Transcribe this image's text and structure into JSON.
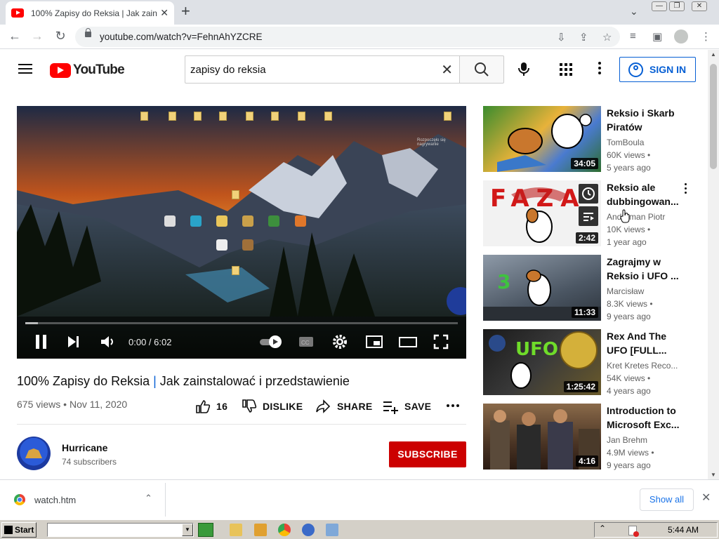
{
  "browser": {
    "tab_title": "100% Zapisy do Reksia | Jak zainstalować i przedstawienie",
    "url": "youtube.com/watch?v=FehnAhYZCRE"
  },
  "masthead": {
    "logo_text": "YouTube",
    "search_query": "zapisy do reksia",
    "sign_in_label": "SIGN IN"
  },
  "player": {
    "time": "0:00 / 6:02",
    "overlay_text": "Rozpoczęło się nagrywanie",
    "progress": 0
  },
  "video": {
    "title_part1": "100% Zapisy do Reksia",
    "title_sep": " | ",
    "title_part2": "Jak zainstalować i przedstawienie",
    "views": "675 views",
    "date": "Nov 11, 2020",
    "likes": "16",
    "dislike_label": "DISLIKE",
    "share_label": "SHARE",
    "save_label": "SAVE"
  },
  "channel": {
    "name": "Hurricane",
    "subscribers": "74 subscribers",
    "subscribe_label": "SUBSCRIBE"
  },
  "sidebar": [
    {
      "title": "Reksio i Skarb Piratów",
      "channel": "TomBoula",
      "views": "60K views •",
      "age": "5 years ago",
      "duration": "34:05"
    },
    {
      "title": "Reksio ale dubbingowan...",
      "channel": "Andruman Piotr",
      "views": "10K views •",
      "age": "1 year ago",
      "duration": "2:42",
      "thumb_text": "FAZA"
    },
    {
      "title": "Zagrajmy w Reksio i UFO ...",
      "channel": "Marcisław",
      "views": "8.3K views •",
      "age": "9 years ago",
      "duration": "11:33",
      "thumb_text": "3"
    },
    {
      "title": "Rex And The UFO [FULL...",
      "channel": "Kret Kretes Reco...",
      "views": "54K views •",
      "age": "4 years ago",
      "duration": "1:25:42",
      "thumb_text": "UFO"
    },
    {
      "title": "Introduction to Microsoft Exc...",
      "channel": "Jan Brehm",
      "views": "4.9M views •",
      "age": "9 years ago",
      "duration": "4:16"
    }
  ],
  "downloads": {
    "file_name": "watch.htm",
    "show_all_label": "Show all"
  },
  "taskbar": {
    "start_label": "Start",
    "clock": "5:44 AM"
  }
}
